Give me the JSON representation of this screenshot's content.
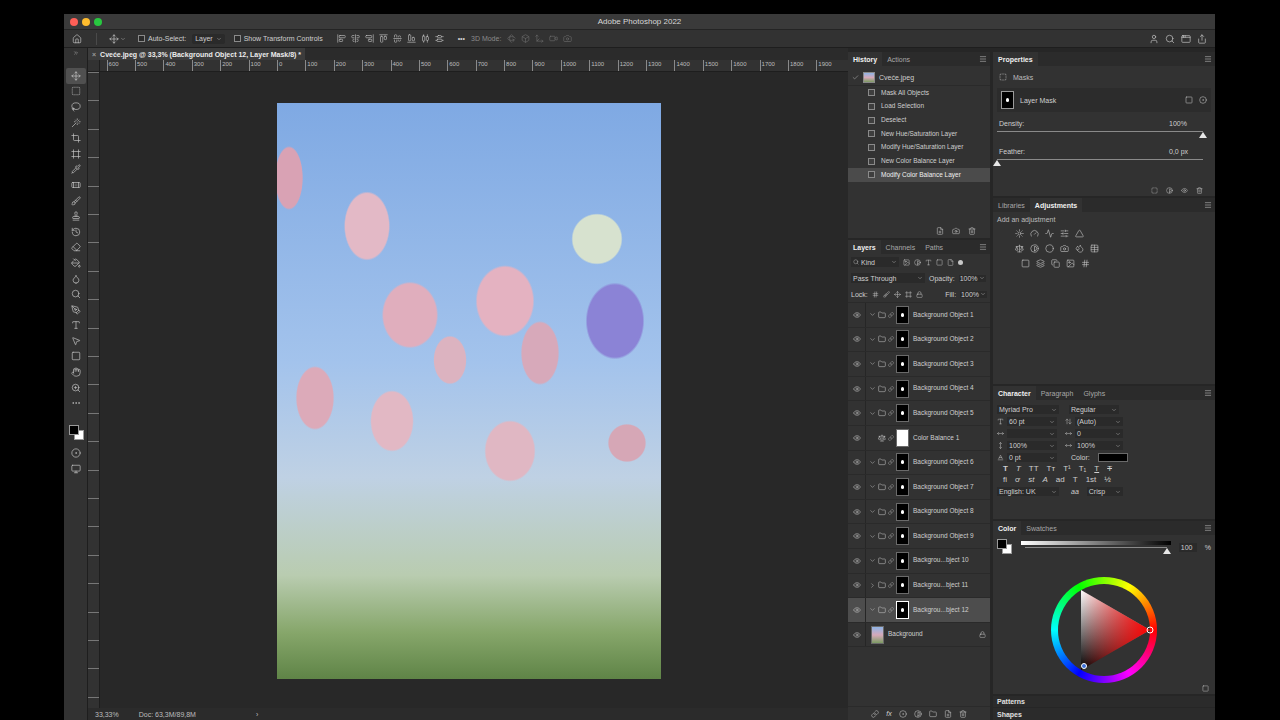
{
  "window": {
    "title": "Adobe Photoshop 2022"
  },
  "options_bar": {
    "auto_select": {
      "label": "Auto-Select:",
      "checked": false
    },
    "auto_select_target": "Layer",
    "show_transform": {
      "label": "Show Transform Controls",
      "checked": false
    },
    "more": "•••",
    "mode_3d": "3D Mode:"
  },
  "tools": [
    {
      "selected": true
    },
    {
      "selected": false
    },
    {
      "selected": false
    },
    {
      "selected": false
    },
    {
      "selected": false
    },
    {
      "selected": false
    },
    {
      "selected": false
    },
    {
      "selected": false
    },
    {
      "selected": false
    },
    {
      "selected": false
    },
    {
      "selected": false
    },
    {
      "selected": false
    },
    {
      "selected": false
    },
    {
      "selected": false
    },
    {
      "selected": false
    },
    {
      "selected": false
    },
    {
      "selected": false
    },
    {
      "selected": false
    },
    {
      "selected": false
    },
    {
      "selected": false
    },
    {
      "selected": false
    },
    {
      "selected": false
    }
  ],
  "document": {
    "close": "×",
    "tab": "Cveće.jpeg @ 33,3% (Background Object 12, Layer Mask/8) *",
    "ruler": [
      "600",
      "500",
      "400",
      "300",
      "200",
      "100",
      "0",
      "100",
      "200",
      "300",
      "400",
      "500",
      "600",
      "700",
      "800",
      "900",
      "1000",
      "1100",
      "1200",
      "1300",
      "1400",
      "1500",
      "1600",
      "1700",
      "1800",
      "1900"
    ],
    "zoom": "33,33%",
    "doc_info": "Doc: 63,3M/89,8M",
    "status_arrow": "›"
  },
  "history": {
    "tabs": [
      {
        "label": "History",
        "selected": true
      },
      {
        "label": "Actions",
        "selected": false
      }
    ],
    "snapshot": "Cveće.jpeg",
    "items": [
      {
        "label": "Mask All Objects",
        "selected": false
      },
      {
        "label": "Load Selection",
        "selected": false
      },
      {
        "label": "Deselect",
        "selected": false
      },
      {
        "label": "New Hue/Saturation Layer",
        "selected": false
      },
      {
        "label": "Modify Hue/Saturation Layer",
        "selected": false
      },
      {
        "label": "New Color Balance Layer",
        "selected": false
      },
      {
        "label": "Modify Color Balance Layer",
        "selected": true
      }
    ]
  },
  "layers": {
    "tabs": [
      {
        "label": "Layers",
        "selected": true
      },
      {
        "label": "Channels",
        "selected": false
      },
      {
        "label": "Paths",
        "selected": false
      }
    ],
    "filter": "Kind",
    "blend_mode": "Pass Through",
    "opacity_label": "Opacity:",
    "opacity": "100%",
    "lock_label": "Lock:",
    "fill_label": "Fill:",
    "fill": "100%",
    "fx": "fx",
    "items": [
      {
        "name": "Background Object 1",
        "kind": "group",
        "visible": true,
        "expanded": true,
        "selected": false,
        "locked": false
      },
      {
        "name": "Background Object 2",
        "kind": "group",
        "visible": true,
        "expanded": true,
        "selected": false,
        "locked": false
      },
      {
        "name": "Background Object 3",
        "kind": "group",
        "visible": true,
        "expanded": true,
        "selected": false,
        "locked": false
      },
      {
        "name": "Background Object 4",
        "kind": "group",
        "visible": true,
        "expanded": true,
        "selected": false,
        "locked": false
      },
      {
        "name": "Background Object 5",
        "kind": "group",
        "visible": true,
        "expanded": true,
        "selected": false,
        "locked": false
      },
      {
        "name": "Color Balance 1",
        "kind": "adjustment",
        "visible": true,
        "expanded": false,
        "selected": false,
        "locked": false
      },
      {
        "name": "Background Object 6",
        "kind": "group",
        "visible": true,
        "expanded": true,
        "selected": false,
        "locked": false
      },
      {
        "name": "Background Object 7",
        "kind": "group",
        "visible": true,
        "expanded": true,
        "selected": false,
        "locked": false
      },
      {
        "name": "Background Object 8",
        "kind": "group",
        "visible": true,
        "expanded": true,
        "selected": false,
        "locked": false
      },
      {
        "name": "Background Object 9",
        "kind": "group",
        "visible": true,
        "expanded": true,
        "selected": false,
        "locked": false
      },
      {
        "name": "Backgrou...bject 10",
        "kind": "group",
        "visible": true,
        "expanded": true,
        "selected": false,
        "locked": false
      },
      {
        "name": "Backgrou...bject 11",
        "kind": "group",
        "visible": true,
        "expanded": false,
        "selected": false,
        "locked": false
      },
      {
        "name": "Backgrou...bject 12",
        "kind": "group",
        "visible": true,
        "expanded": true,
        "selected": true,
        "locked": false
      },
      {
        "name": "Background",
        "kind": "image",
        "visible": true,
        "expanded": false,
        "selected": false,
        "locked": true
      }
    ]
  },
  "properties": {
    "tabs": [
      {
        "label": "Properties",
        "selected": true
      }
    ],
    "section": "Masks",
    "mask_label": "Layer Mask",
    "density": {
      "label": "Density:",
      "value": "100%",
      "level": 1
    },
    "feather": {
      "label": "Feather:",
      "value": "0,0 px",
      "level": 0
    }
  },
  "adjustments": {
    "tabs": [
      {
        "label": "Libraries",
        "selected": false
      },
      {
        "label": "Adjustments",
        "selected": true
      }
    ],
    "hint": "Add an adjustment"
  },
  "character": {
    "tabs": [
      {
        "label": "Character",
        "selected": true
      },
      {
        "label": "Paragraph",
        "selected": false
      },
      {
        "label": "Glyphs",
        "selected": false
      }
    ],
    "font": "Myriad Pro",
    "style": "Regular",
    "size": "60 pt",
    "leading": "(Auto)",
    "kerning": "",
    "tracking": "0",
    "vertical_scale": "100%",
    "horizontal_scale": "100%",
    "baseline": "0 pt",
    "color_label": "Color:",
    "color": "#000000",
    "styles": [
      "T",
      "T",
      "TT",
      "Tт",
      "T¹",
      "T₁",
      "T",
      "T"
    ],
    "opentype": [
      "fi",
      "ơ",
      "st",
      "A",
      "ad",
      "T",
      "1st",
      "½"
    ],
    "language": "English: UK",
    "aa_label": "aa",
    "antialias": "Crisp"
  },
  "color": {
    "tabs": [
      {
        "label": "Color",
        "selected": true
      },
      {
        "label": "Swatches",
        "selected": false
      }
    ],
    "foreground": "#000000",
    "background": "#ffffff",
    "slider": {
      "level": 1,
      "value": "100",
      "unit": "%"
    }
  },
  "collapsed_panels": [
    {
      "label": "Patterns"
    },
    {
      "label": "Shapes"
    }
  ]
}
